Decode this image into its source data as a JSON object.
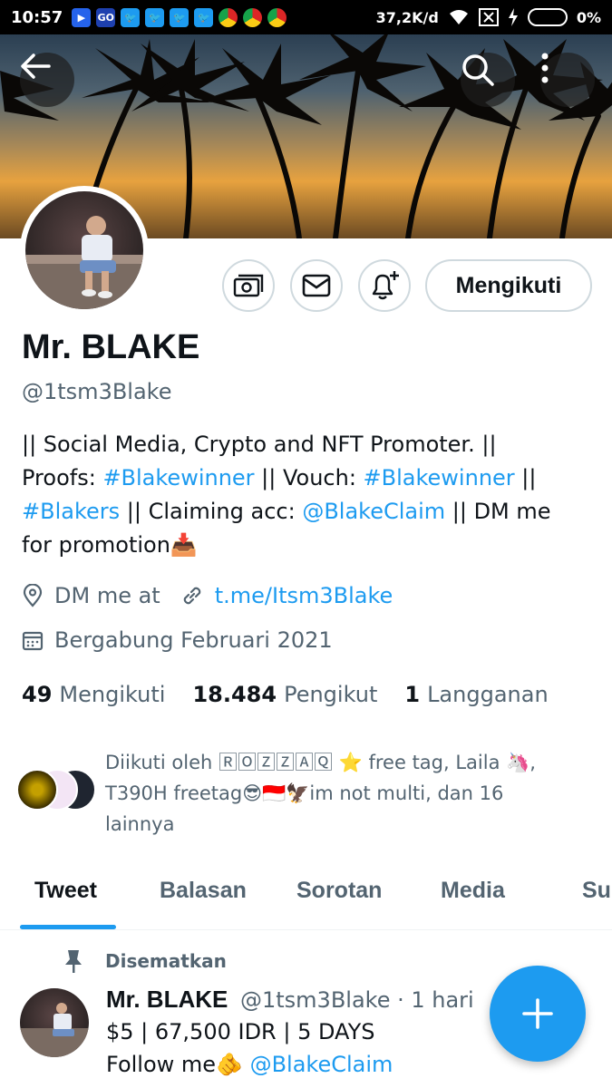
{
  "status_bar": {
    "time": "10:57",
    "network_speed": "37,2K/d",
    "battery": "0%",
    "apps": [
      {
        "icon": "play-store-icon",
        "color": "#3b82f6"
      },
      {
        "icon": "go-icon",
        "label": "GO",
        "color": "#2563eb"
      },
      {
        "icon": "twitter-icon",
        "color": "#1d9bf0"
      },
      {
        "icon": "twitter-icon",
        "color": "#1d9bf0"
      },
      {
        "icon": "twitter-icon",
        "color": "#1d9bf0"
      },
      {
        "icon": "twitter-icon",
        "color": "#1d9bf0"
      },
      {
        "icon": "chrome-icon",
        "color": "#dc2626"
      },
      {
        "icon": "chrome-icon",
        "color": "#dc2626"
      },
      {
        "icon": "chrome-icon",
        "color": "#dc2626"
      }
    ]
  },
  "header": {
    "back_icon": "arrow-left-icon",
    "search_icon": "search-icon",
    "more_icon": "more-vertical-icon"
  },
  "actions": {
    "tip_icon": "money-icon",
    "message_icon": "mail-icon",
    "notify_icon": "bell-plus-icon",
    "follow_label": "Mengikuti"
  },
  "profile": {
    "name": "Mr. BLAKE",
    "handle": "@1tsm3Blake",
    "bio": {
      "p1": "|| Social Media, Crypto and NFT Promoter. ||",
      "p2": "Proofs: ",
      "tag1": "#Blakewinner",
      "p3": " || Vouch: ",
      "tag2": "#Blakewinner",
      "p4": " ||",
      "tag3": "#Blakers",
      "p5": " || Claiming acc: ",
      "mention": "@BlakeClaim",
      "p6": " || DM me",
      "p7": "for promotion",
      "emoji": "📥"
    },
    "location": "DM me at",
    "website": "t.me/Itsm3Blake",
    "joined": "Bergabung Februari 2021"
  },
  "stats": [
    {
      "count": "49",
      "label": "Mengikuti"
    },
    {
      "count": "18.484",
      "label": "Pengikut"
    },
    {
      "count": "1",
      "label": "Langganan"
    }
  ],
  "followed_by": {
    "line1": "Diikuti oleh 🅁🄾🅉🅉🄰🅀 ⭐ free tag, Laila 🦄,",
    "line2": "T390H freetag😎🇮🇩🦅im not multi, dan 16",
    "line3": "lainnya"
  },
  "tabs": [
    "Tweet",
    "Balasan",
    "Sorotan",
    "Media",
    "Su"
  ],
  "pinned_tweet": {
    "pinned_label": "Disematkan",
    "author_name": "Mr. BLAKE",
    "author_handle": "@1tsm3Blake",
    "time": "· 1 hari",
    "line1": "$5 | 67,500 IDR | 5 DAYS",
    "line2_text": "Follow me",
    "line2_emoji": "🫵",
    "line2_mention": "@BlakeClaim"
  },
  "fab": {
    "icon": "plus-icon"
  },
  "colors": {
    "accent": "#1d9bf0",
    "text": "#0f1419",
    "secondary": "#536471"
  }
}
